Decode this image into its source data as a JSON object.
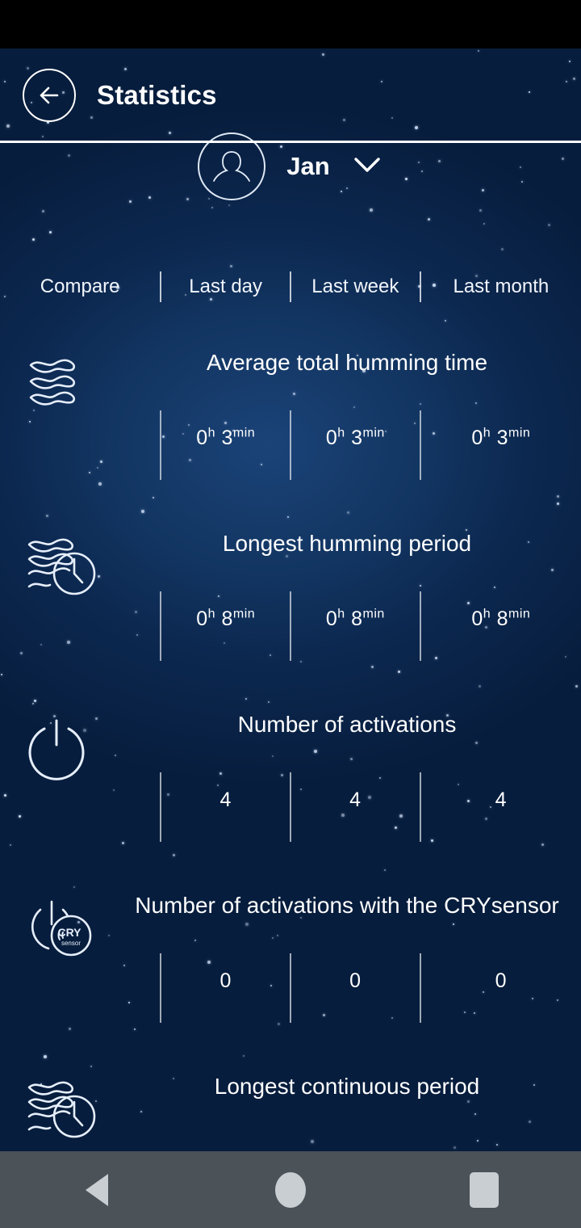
{
  "header": {
    "title": "Statistics",
    "back_icon": "arrow-left-icon"
  },
  "user": {
    "name": "Jan",
    "avatar_icon": "person-avatar-icon",
    "dropdown_icon": "chevron-down-icon"
  },
  "columns": {
    "compare_label": "Compare",
    "periods": [
      "Last day",
      "Last week",
      "Last month"
    ]
  },
  "metrics": [
    {
      "icon": "humming-waves-icon",
      "label": "Average total humming time",
      "values": [
        {
          "h": "0",
          "h_unit": "h",
          "m": "3",
          "m_unit": "min"
        },
        {
          "h": "0",
          "h_unit": "h",
          "m": "3",
          "m_unit": "min"
        },
        {
          "h": "0",
          "h_unit": "h",
          "m": "3",
          "m_unit": "min"
        }
      ]
    },
    {
      "icon": "humming-waves-clock-icon",
      "label": "Longest humming period",
      "values": [
        {
          "h": "0",
          "h_unit": "h",
          "m": "8",
          "m_unit": "min"
        },
        {
          "h": "0",
          "h_unit": "h",
          "m": "8",
          "m_unit": "min"
        },
        {
          "h": "0",
          "h_unit": "h",
          "m": "8",
          "m_unit": "min"
        }
      ]
    },
    {
      "icon": "power-button-icon",
      "label": "Number of activations",
      "values": [
        {
          "plain": "4"
        },
        {
          "plain": "4"
        },
        {
          "plain": "4"
        }
      ]
    },
    {
      "icon": "power-crysensor-icon",
      "label": "Number of activations with the CRYsensor",
      "values": [
        {
          "plain": "0"
        },
        {
          "plain": "0"
        },
        {
          "plain": "0"
        }
      ]
    },
    {
      "icon": "humming-waves-clock-icon",
      "label": "Longest continuous period",
      "values": []
    }
  ],
  "nav_bar": {
    "back": "nav-back-icon",
    "home": "nav-home-icon",
    "recents": "nav-recents-icon"
  },
  "colors": {
    "bg_top": "#0a2347",
    "bg_mid": "#1b4378",
    "bg_bottom": "#06193a",
    "text": "#ffffff",
    "nav_bar": "#4b5258",
    "nav_icon": "#c9ced2",
    "status_bar": "#000000"
  }
}
